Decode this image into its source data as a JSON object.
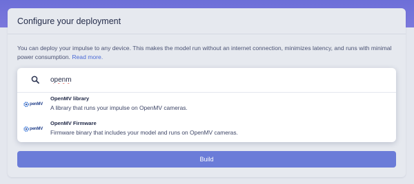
{
  "card": {
    "title": "Configure your deployment",
    "description": "You can deploy your impulse to any device. This makes the model run without an internet connection, minimizes latency, and runs with minimal power consumption.",
    "read_more": "Read more."
  },
  "search": {
    "value": "openm",
    "icon": "search-icon"
  },
  "results": [
    {
      "logo_text": "penMV",
      "title": "OpenMV library",
      "subtitle": "A library that runs your impulse on OpenMV cameras."
    },
    {
      "logo_text": "penMV",
      "title": "OpenMV Firmware",
      "subtitle": "Firmware binary that includes your model and runs on OpenMV cameras."
    }
  ],
  "build_button": {
    "label": "Build"
  },
  "colors": {
    "accent": "#6b7cd8",
    "header_gradient": "#6d6fd8",
    "background": "#e4e7ee",
    "link": "#4b6bd6"
  }
}
